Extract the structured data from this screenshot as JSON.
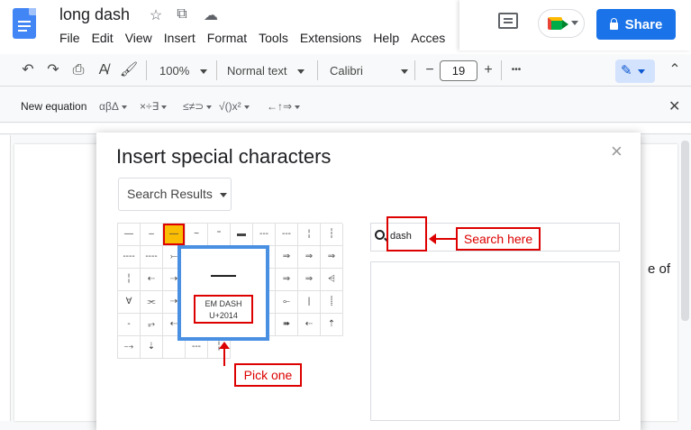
{
  "doc": {
    "title": "long dash",
    "body_fragment": "e of"
  },
  "menu": [
    "File",
    "Edit",
    "View",
    "Insert",
    "Format",
    "Tools",
    "Extensions",
    "Help",
    "Acces"
  ],
  "share": {
    "label": "Share"
  },
  "toolbar": {
    "zoom": "100%",
    "style": "Normal text",
    "font": "Calibri",
    "size": "19",
    "minus": "−",
    "plus": "+",
    "more": "•••"
  },
  "equation": {
    "label": "New equation",
    "groups": [
      "αβΔ",
      "×÷∃",
      "≤≠⊃",
      "√()x²",
      "←↑⇒"
    ],
    "close": "✕"
  },
  "dialog": {
    "title": "Insert special characters",
    "close": "×",
    "category": "Search Results",
    "search_value": "dash",
    "grid": [
      "—",
      "–",
      "—",
      "~",
      "⁼",
      "▬",
      "---",
      "---",
      "¦",
      "┆",
      "----",
      "----",
      "⤚",
      "",
      "",
      "",
      "",
      "⇒",
      "⇒",
      "⇒",
      "╎",
      "⇠",
      "⇢",
      "",
      "",
      "",
      "",
      "⇒",
      "⇒",
      "⩤",
      "∀",
      "⫘",
      "⇢",
      "",
      "",
      "",
      "",
      "⟜",
      "|",
      "⸽",
      "-",
      "⥅",
      "⇠",
      "",
      "",
      "",
      "",
      "➠",
      "⇠",
      "⇡",
      "⤍",
      "⇣",
      "",
      "---",
      "╎"
    ],
    "preview": {
      "char": "—",
      "name": "EM DASH",
      "code": "U+2014"
    }
  },
  "annotations": {
    "search": "Search here",
    "pick": "Pick one"
  },
  "colors": {
    "share": "#1a73e8",
    "highlight": "#fbbc04",
    "annotation": "#dd0000",
    "popup_border": "#4a90e2"
  }
}
